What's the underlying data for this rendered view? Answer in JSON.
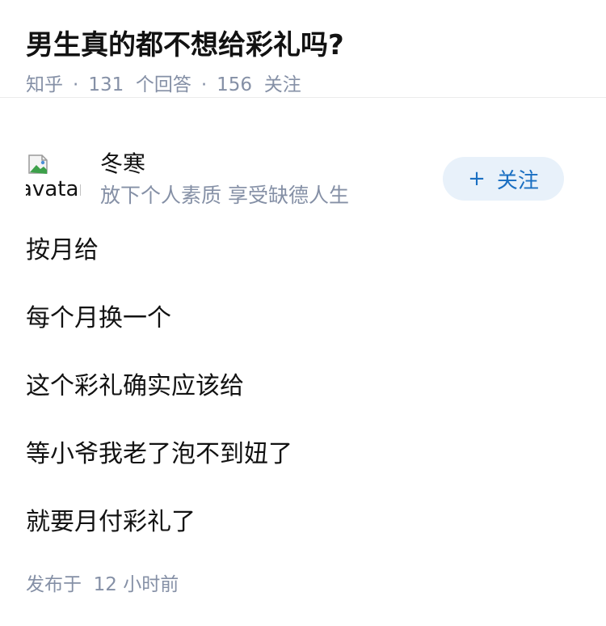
{
  "question": {
    "title": "男生真的都不想给彩礼吗?",
    "source": "知乎",
    "separator": "·",
    "answer_count": "131",
    "answer_label": "个回答",
    "follow_count": "156",
    "follow_label": "关注"
  },
  "author": {
    "avatar_alt": "avatar",
    "name": "冬寒",
    "bio": "放下个人素质 享受缺德人生",
    "follow_button_plus": "+",
    "follow_button_label": "关注"
  },
  "answer": {
    "lines": [
      "按月给",
      "每个月换一个",
      "这个彩礼确实应该给",
      "等小爷我老了泡不到妞了",
      "就要月付彩礼了"
    ],
    "published_label": "发布于",
    "published_time": "12 小时前"
  },
  "colors": {
    "meta_gray": "#8590a6",
    "follow_bg": "#e8f1fa",
    "follow_text": "#1a6fc2",
    "divider": "#ebebeb"
  },
  "icons": {
    "avatar": "broken-image-icon"
  }
}
